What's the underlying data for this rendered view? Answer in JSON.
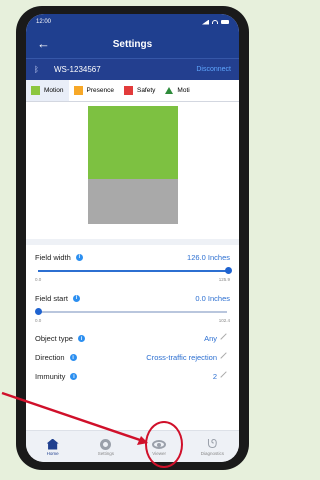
{
  "statusbar": {
    "time": "12:00"
  },
  "header": {
    "title": "Settings",
    "back_icon": "arrow-left-icon"
  },
  "device": {
    "name": "WS-1234567",
    "action": "Disconnect",
    "icon": "bluetooth-icon"
  },
  "tabs": [
    {
      "label": "Motion",
      "color": "#8cc63f",
      "active": true
    },
    {
      "label": "Presence",
      "color": "#f7a828"
    },
    {
      "label": "Safety",
      "color": "#e23b3b"
    },
    {
      "label": "Moti",
      "color": "#2e8b3a"
    }
  ],
  "preview": {
    "colors": {
      "field": "#7dc141",
      "start": "#a9a9a9"
    }
  },
  "settings": {
    "field_width": {
      "label": "Field width",
      "value": "126.0 Inches",
      "min": "0.0",
      "max": "125.9",
      "fraction": 0.98
    },
    "field_start": {
      "label": "Field start",
      "value": "0.0 Inches",
      "min": "0.0",
      "max": "102.4",
      "fraction": 0.0
    },
    "object_type": {
      "label": "Object type",
      "value": "Any"
    },
    "direction": {
      "label": "Direction",
      "value": "Cross-traffic rejection"
    },
    "immunity": {
      "label": "Immunity",
      "value": "2"
    }
  },
  "tabbar": [
    {
      "label": "Home",
      "icon": "home-icon"
    },
    {
      "label": "Settings",
      "icon": "gear-icon"
    },
    {
      "label": "Viewer",
      "icon": "eye-icon"
    },
    {
      "label": "Diagnostics",
      "icon": "stethoscope-icon"
    }
  ],
  "annotation": {
    "color": "#d0102a"
  }
}
